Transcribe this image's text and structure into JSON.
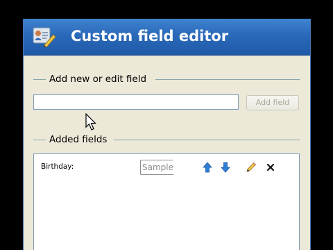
{
  "window": {
    "title": "Custom field editor",
    "title_icon": "contact-card-edit-icon"
  },
  "add_section": {
    "heading": "Add new or edit field",
    "input_value": "",
    "input_placeholder": "",
    "add_button_label": "Add field",
    "add_button_enabled": false
  },
  "added_section": {
    "heading": "Added fields",
    "fields": [
      {
        "label": "Birthday:",
        "sample": "Sample",
        "actions": [
          "move-up-icon",
          "move-down-icon",
          "edit-pencil-icon",
          "delete-x-icon"
        ]
      }
    ]
  },
  "colors": {
    "titlebar": "#2a69b9",
    "window_bg": "#ece9d8",
    "arrow_blue": "#2f7fd6",
    "section_line": "#8aa6a8"
  }
}
